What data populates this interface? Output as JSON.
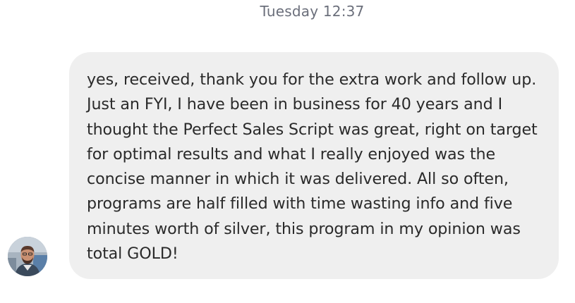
{
  "conversation": {
    "timestamp": "Tuesday 12:37",
    "message": {
      "avatar_icon": "user-avatar-photo",
      "text": "yes, received, thank you for the extra work and follow up. Just an FYI, I have been in business for 40 years and I thought the Perfect Sales Script was great, right on target for optimal results and what I really enjoyed was the concise manner in which it was delivered. All so often, programs are half filled with time wasting info and five minutes worth of silver, this program in my opinion was total GOLD!"
    }
  },
  "colors": {
    "bubble_background": "#efefef",
    "message_text": "#2a2a2a",
    "timestamp_text": "#6b6f7b"
  }
}
